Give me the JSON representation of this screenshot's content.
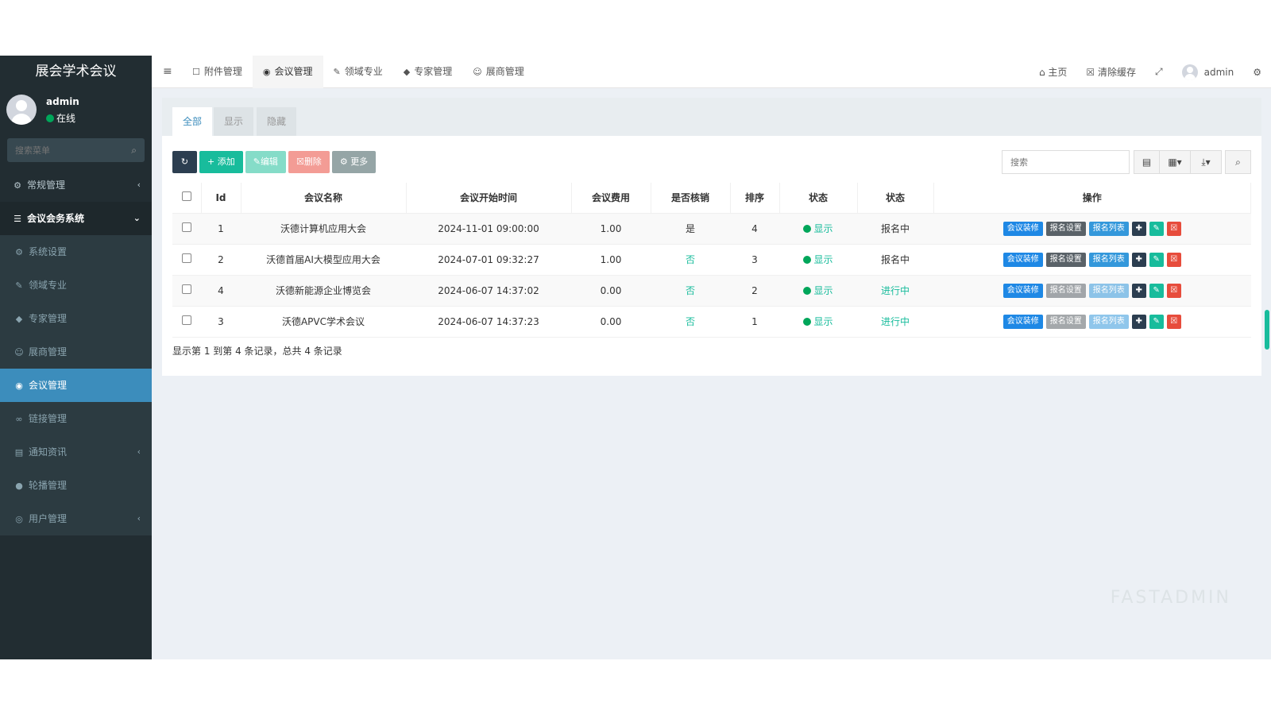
{
  "sidebar": {
    "brand": "展会学术会议",
    "user_name": "admin",
    "user_status": "在线",
    "search_placeholder": "搜索菜单",
    "items": [
      {
        "label": "常规管理",
        "icon": "cogs-icon"
      },
      {
        "label": "会议会务系统",
        "icon": "list-icon"
      },
      {
        "label": "系统设置",
        "icon": "gear-icon"
      },
      {
        "label": "领域专业",
        "icon": "pencil-icon"
      },
      {
        "label": "专家管理",
        "icon": "graduation-cap-icon"
      },
      {
        "label": "展商管理",
        "icon": "users-icon"
      },
      {
        "label": "会议管理",
        "icon": "circle-gear-icon"
      },
      {
        "label": "链接管理",
        "icon": "link-icon"
      },
      {
        "label": "通知资讯",
        "icon": "newspaper-icon"
      },
      {
        "label": "轮播管理",
        "icon": "circle-icon"
      },
      {
        "label": "用户管理",
        "icon": "user-circle-icon"
      }
    ]
  },
  "topnav": {
    "tabs": [
      {
        "label": "附件管理",
        "icon": "file-icon"
      },
      {
        "label": "会议管理",
        "icon": "circle-gear-icon"
      },
      {
        "label": "领域专业",
        "icon": "pencil-icon"
      },
      {
        "label": "专家管理",
        "icon": "graduation-cap-icon"
      },
      {
        "label": "展商管理",
        "icon": "users-icon"
      }
    ],
    "home": "主页",
    "clear_cache": "清除缓存",
    "user": "admin"
  },
  "filter_tabs": [
    "全部",
    "显示",
    "隐藏"
  ],
  "toolbar": {
    "add": "添加",
    "edit": "编辑",
    "delete": "删除",
    "more": "更多",
    "search_placeholder": "搜索"
  },
  "table": {
    "columns": [
      "Id",
      "会议名称",
      "会议开始时间",
      "会议费用",
      "是否核销",
      "排序",
      "状态",
      "状态",
      "操作"
    ],
    "rows": [
      {
        "id": "1",
        "name": "沃德计算机应用大会",
        "start": "2024-11-01 09:00:00",
        "fee": "1.00",
        "verify": "是",
        "sort": "4",
        "show": "显示",
        "stage": "报名中"
      },
      {
        "id": "2",
        "name": "沃德首届AI大模型应用大会",
        "start": "2024-07-01 09:32:27",
        "fee": "1.00",
        "verify": "否",
        "sort": "3",
        "show": "显示",
        "stage": "报名中"
      },
      {
        "id": "4",
        "name": "沃德新能源企业博览会",
        "start": "2024-06-07 14:37:02",
        "fee": "0.00",
        "verify": "否",
        "sort": "2",
        "show": "显示",
        "stage": "进行中"
      },
      {
        "id": "3",
        "name": "沃德APVC学术会议",
        "start": "2024-06-07 14:37:23",
        "fee": "0.00",
        "verify": "否",
        "sort": "1",
        "show": "显示",
        "stage": "进行中"
      }
    ],
    "op_labels": [
      "会议装修",
      "报名设置",
      "报名列表"
    ]
  },
  "pagination_info": "显示第 1 到第 4 条记录，总共 4 条记录",
  "watermark": "FASTADMIN",
  "colors": {
    "primary": "#3c8dbc",
    "success": "#18bc9c",
    "danger": "#e74c3c",
    "sidebar": "#222d32"
  }
}
